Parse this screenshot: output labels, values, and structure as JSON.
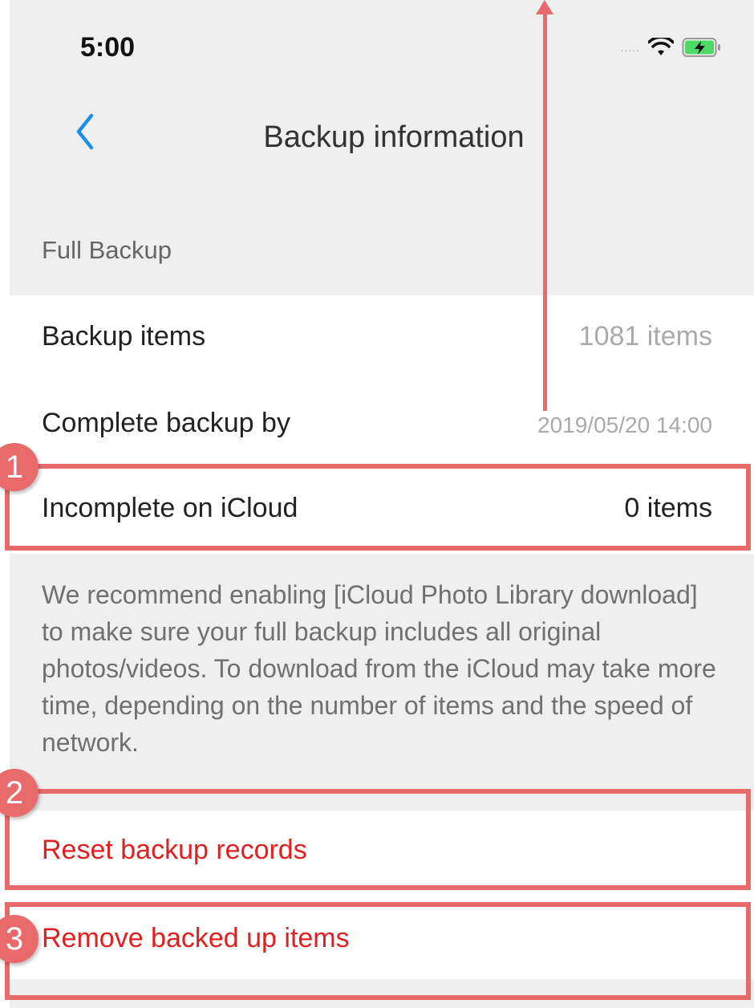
{
  "status_bar": {
    "time": "5:00",
    "signal": ".....",
    "icons": [
      "signal-dots-icon",
      "wifi-icon",
      "battery-charging-icon"
    ]
  },
  "nav": {
    "back_icon": "chevron-left-icon",
    "title": "Backup information"
  },
  "section": {
    "header": "Full Backup"
  },
  "rows": [
    {
      "label": "Backup items",
      "value": "1081 items"
    },
    {
      "label": "Complete backup by",
      "value": "2019/05/20 14:00"
    },
    {
      "label": "Incomplete on iCloud",
      "value": "0 items"
    }
  ],
  "note": "We recommend enabling [iCloud Photo Library download] to make sure your full backup includes all original photos/videos. To download from the iCloud may take more time, depending on the number of items and the speed of network.",
  "actions": [
    {
      "label": "Reset backup records"
    },
    {
      "label": "Remove backed up items"
    }
  ],
  "annotations": {
    "badges": [
      "1",
      "2",
      "3"
    ]
  },
  "colors": {
    "accent": "#1e8fe6",
    "destructive": "#e02020",
    "annotation": "#e86a6a",
    "background_gray": "#efefef"
  }
}
